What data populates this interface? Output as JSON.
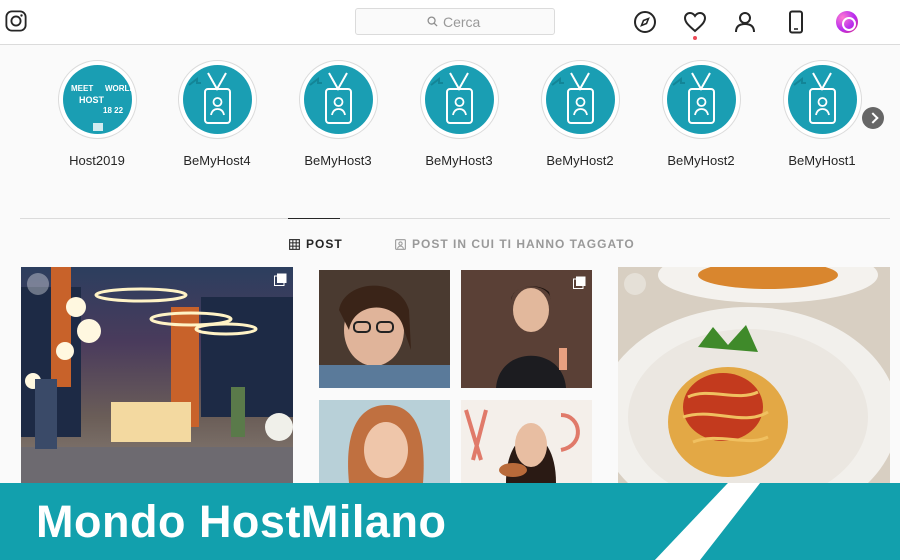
{
  "search": {
    "placeholder": "Cerca"
  },
  "highlights": [
    {
      "label": "Host2019",
      "cover": "meet-host-world"
    },
    {
      "label": "BeMyHost4",
      "cover": "badge-icon"
    },
    {
      "label": "BeMyHost3",
      "cover": "badge-icon"
    },
    {
      "label": "BeMyHost3",
      "cover": "badge-icon"
    },
    {
      "label": "BeMyHost2",
      "cover": "badge-icon"
    },
    {
      "label": "BeMyHost2",
      "cover": "badge-icon"
    },
    {
      "label": "BeMyHost1",
      "cover": "badge-icon"
    }
  ],
  "host2019_cover": {
    "line1": "MEET",
    "line2": "HOST",
    "line3": "WORLD",
    "line4": "18 22"
  },
  "tabs": {
    "post": "POST",
    "tagged": "POST IN CUI TI HANNO TAGGATO"
  },
  "banner": {
    "title": "Mondo HostMilano"
  },
  "colors": {
    "accent": "#1a9eb3",
    "banner": "#12a0ad",
    "notification": "#ed4956"
  }
}
